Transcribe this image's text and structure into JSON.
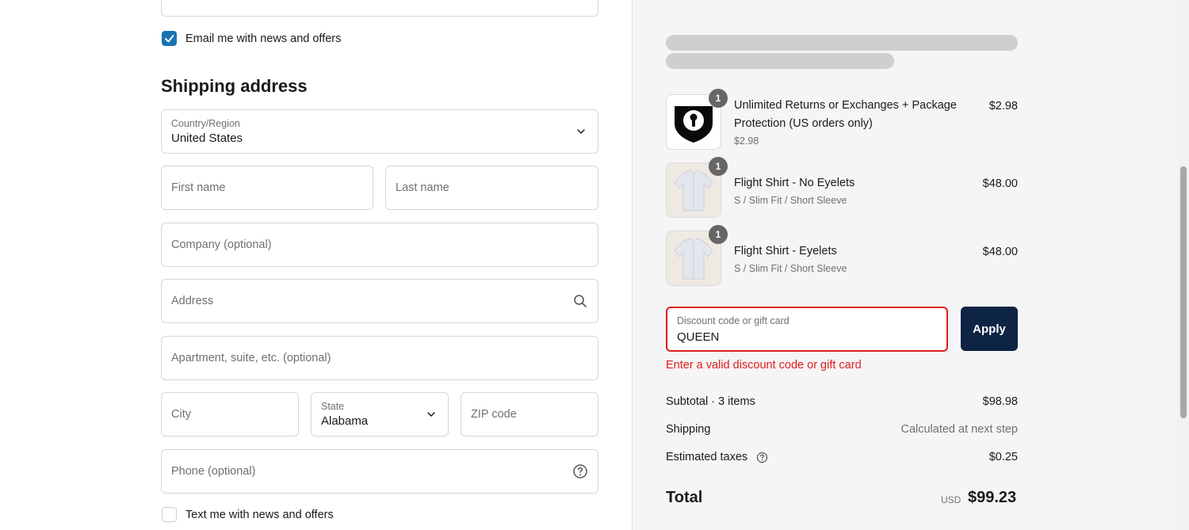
{
  "form": {
    "email_news_label": "Email me with news and offers",
    "email_news_checked": true,
    "shipping_heading": "Shipping address",
    "country_label": "Country/Region",
    "country_value": "United States",
    "first_name_placeholder": "First name",
    "last_name_placeholder": "Last name",
    "company_placeholder": "Company (optional)",
    "address_placeholder": "Address",
    "apartment_placeholder": "Apartment, suite, etc. (optional)",
    "city_placeholder": "City",
    "state_label": "State",
    "state_value": "Alabama",
    "zip_placeholder": "ZIP code",
    "phone_placeholder": "Phone (optional)",
    "text_news_label": "Text me with news and offers",
    "text_news_checked": false
  },
  "order": {
    "items": [
      {
        "title_line1": "Unlimited Returns or Exchanges + Package",
        "title_line2": "Protection (US orders only)",
        "subtitle": "$2.98",
        "price": "$2.98",
        "quantity": "1",
        "icon": "lock-shield-icon"
      },
      {
        "title_line1": "Flight Shirt - No Eyelets",
        "subtitle": "S / Slim Fit / Short Sleeve",
        "price": "$48.00",
        "quantity": "1",
        "icon": "shirt-icon"
      },
      {
        "title_line1": "Flight Shirt - Eyelets",
        "subtitle": "S / Slim Fit / Short Sleeve",
        "price": "$48.00",
        "quantity": "1",
        "icon": "shirt-icon"
      }
    ],
    "discount": {
      "label": "Discount code or gift card",
      "value": "QUEEN",
      "apply_label": "Apply",
      "error": "Enter a valid discount code or gift card"
    },
    "summary": {
      "subtotal_label": "Subtotal · 3 items",
      "subtotal_value": "$98.98",
      "shipping_label": "Shipping",
      "shipping_value": "Calculated at next step",
      "taxes_label": "Estimated taxes",
      "taxes_value": "$0.25",
      "total_label": "Total",
      "total_currency": "USD",
      "total_value": "$99.23"
    }
  },
  "colors": {
    "accent_blue": "#1773b0",
    "apply_button": "#0e2444",
    "error_red": "#dd1d1d"
  }
}
